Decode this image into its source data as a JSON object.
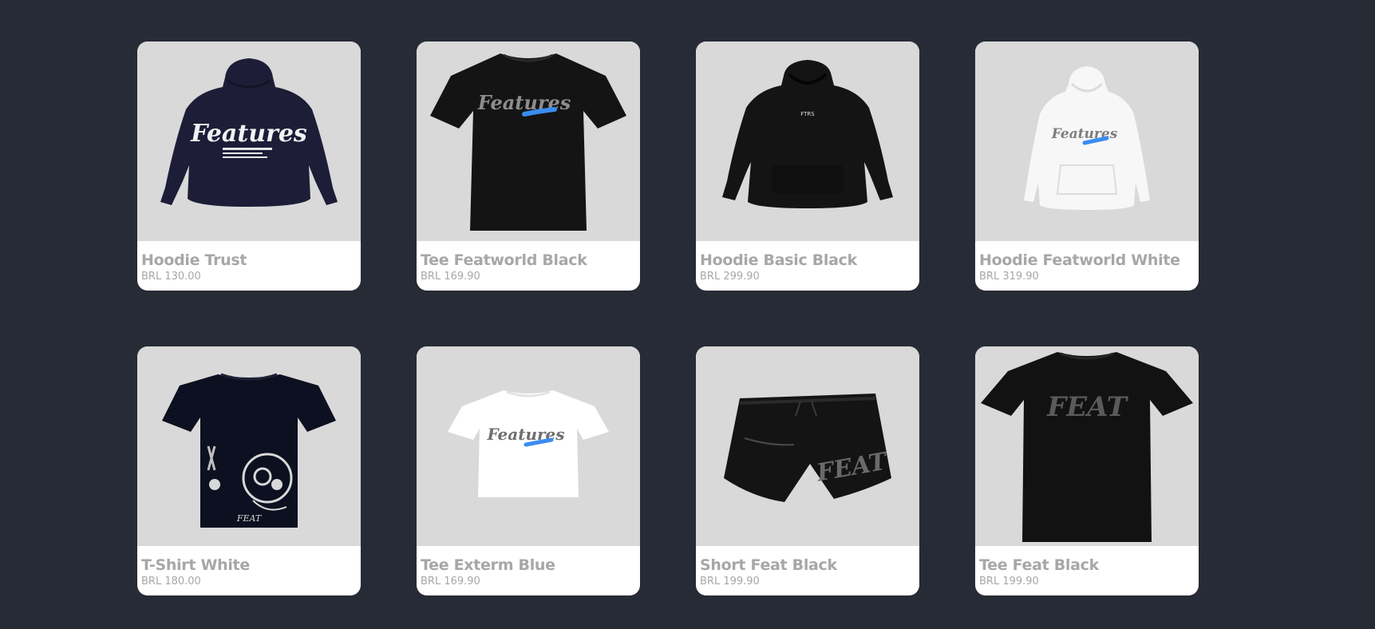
{
  "products": [
    {
      "name": "Hoodie Trust",
      "price": "BRL 130.00",
      "image": "navy-hoodie-back-print",
      "print": "Features"
    },
    {
      "name": "Tee Featworld Black",
      "price": "BRL 169.90",
      "image": "black-tee-featworld-print",
      "print": "Features"
    },
    {
      "name": "Hoodie Basic Black",
      "price": "BRL 299.90",
      "image": "black-hoodie-small-logo",
      "print": "FTRS"
    },
    {
      "name": "Hoodie Featworld White",
      "price": "BRL 319.90",
      "image": "white-hoodie-featworld-print",
      "print": "Features"
    },
    {
      "name": "T-Shirt White",
      "price": "BRL 180.00",
      "image": "navy-tee-gasmask-print",
      "print": "FEAT"
    },
    {
      "name": "Tee Exterm Blue",
      "price": "BRL 169.90",
      "image": "white-tee-featworld-print",
      "print": "Features"
    },
    {
      "name": "Short Feat Black",
      "price": "BRL 199.90",
      "image": "black-shorts-feat-print",
      "print": "FEAT"
    },
    {
      "name": "Tee Feat Black",
      "price": "BRL 199.90",
      "image": "black-tee-feat-print",
      "print": "FEAT"
    }
  ],
  "colors": {
    "page_background": "#272b35",
    "image_background": "#d9d9d9",
    "text_muted": "#a7a7a7",
    "accent_blue": "#3a8cf0"
  }
}
